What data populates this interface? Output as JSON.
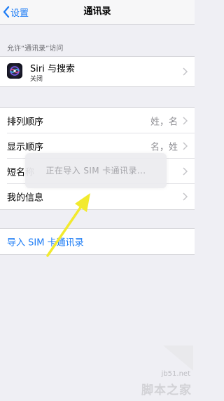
{
  "nav": {
    "back_label": "设置",
    "title": "通讯录"
  },
  "access": {
    "header": "允许“通讯录”访问",
    "siri_title": "Siri 与搜索",
    "siri_subtitle": "关闭"
  },
  "settings": {
    "sort_label": "排列顺序",
    "sort_value": "姓，名",
    "display_label": "显示顺序",
    "display_value": "名，姓",
    "short_name_label": "短名称",
    "my_info_label": "我的信息"
  },
  "import": {
    "label": "导入 SIM 卡通讯录"
  },
  "toast": {
    "text": "正在导入 SIM 卡通讯录..."
  },
  "watermark": {
    "site": "jb51.net",
    "logo": "脚本之家"
  },
  "colors": {
    "accent": "#1b7bf5",
    "arrow": "#f2ea2e",
    "background": "#efeff4"
  }
}
